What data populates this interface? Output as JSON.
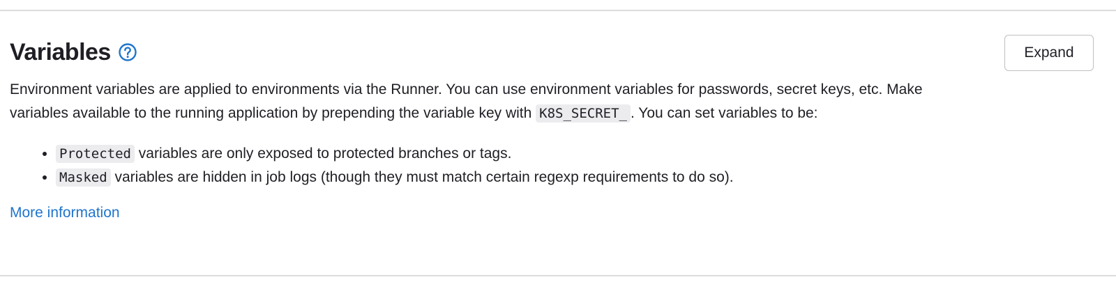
{
  "section": {
    "title": "Variables",
    "help_icon": "question-circle-icon",
    "expand_label": "Expand",
    "description": {
      "part1": "Environment variables are applied to environments via the Runner. You can use environment variables for passwords, secret keys, etc. Make variables available to the running application by prepending the variable key with ",
      "code": "K8S_SECRET_",
      "part2": ". You can set variables to be:"
    },
    "rules": [
      {
        "code": "Protected",
        "text": " variables are only exposed to protected branches or tags."
      },
      {
        "code": "Masked",
        "text": " variables are hidden in job logs (though they must match certain regexp requirements to do so)."
      }
    ],
    "more_info_label": "More information"
  },
  "colors": {
    "link": "#1f75cb",
    "text": "#1f1e24",
    "divider": "#dcdcde",
    "code_bg": "#ececef"
  }
}
